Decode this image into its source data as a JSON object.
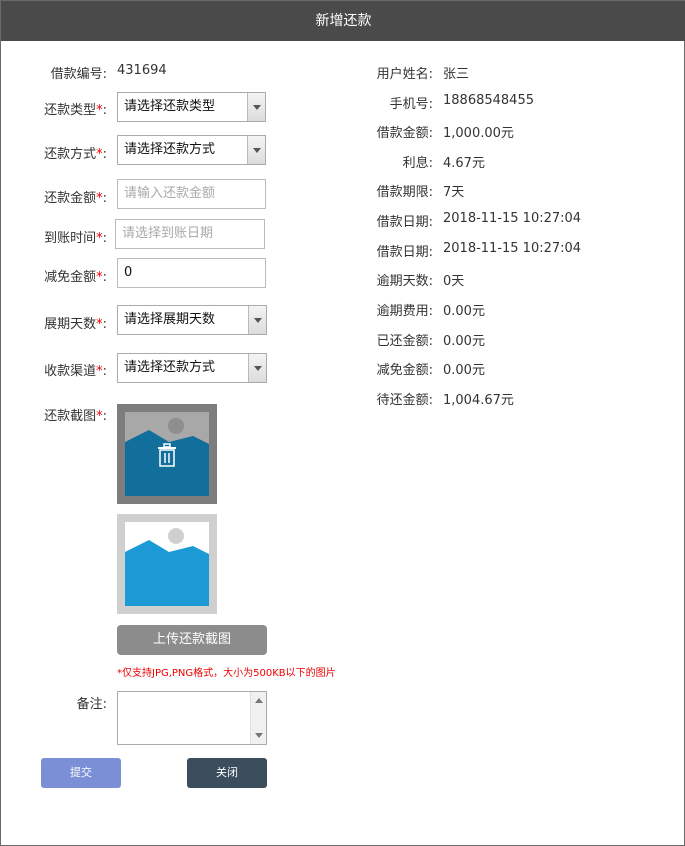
{
  "title": "新增还款",
  "form": {
    "loan_no_label": "借款编号:",
    "loan_no_value": "431694",
    "repay_type_label": "还款类型",
    "repay_type_value": "请选择还款类型",
    "repay_method_label": "还款方式",
    "repay_method_value": "请选择还款方式",
    "repay_amount_label": "还款金额",
    "repay_amount_placeholder": "请输入还款金额",
    "arrival_time_label": "到账时间",
    "arrival_time_placeholder": "请选择到账日期",
    "waive_amount_label": "减免金额",
    "waive_amount_value": "0",
    "extend_days_label": "展期天数",
    "extend_days_value": "请选择展期天数",
    "channel_label": "收款渠道",
    "channel_value": "请选择还款方式",
    "screenshot_label": "还款截图",
    "required_mark": "*",
    "colon": ":",
    "upload_button": "上传还款截图",
    "upload_tip": "*仅支持JPG,PNG格式，大小为500KB以下的图片",
    "remark_label": "备注:",
    "submit_button": "提交",
    "close_button": "关闭"
  },
  "info": [
    {
      "label": "用户姓名:",
      "value": "张三"
    },
    {
      "label": "手机号:",
      "value": "18868548455"
    },
    {
      "label": "借款金额:",
      "value": "1,000.00元"
    },
    {
      "label": "利息:",
      "value": "4.67元"
    },
    {
      "label": "借款期限:",
      "value": "7天"
    },
    {
      "label": "借款日期:",
      "value": "2018-11-15 10:27:04"
    },
    {
      "label": "借款日期:",
      "value": "2018-11-15 10:27:04"
    },
    {
      "label": "逾期天数:",
      "value": "0天"
    },
    {
      "label": "逾期费用:",
      "value": "0.00元"
    },
    {
      "label": "已还金额:",
      "value": "0.00元"
    },
    {
      "label": "减免金额:",
      "value": "0.00元"
    },
    {
      "label": "待还金额:",
      "value": "1,004.67元"
    }
  ],
  "icons": {
    "delete": "trash-icon",
    "image": "image-placeholder-icon"
  },
  "colors": {
    "titlebar": "#4a4a4a",
    "submit": "#7b8fd6",
    "close": "#3b4e5e",
    "required": "#e00000"
  }
}
